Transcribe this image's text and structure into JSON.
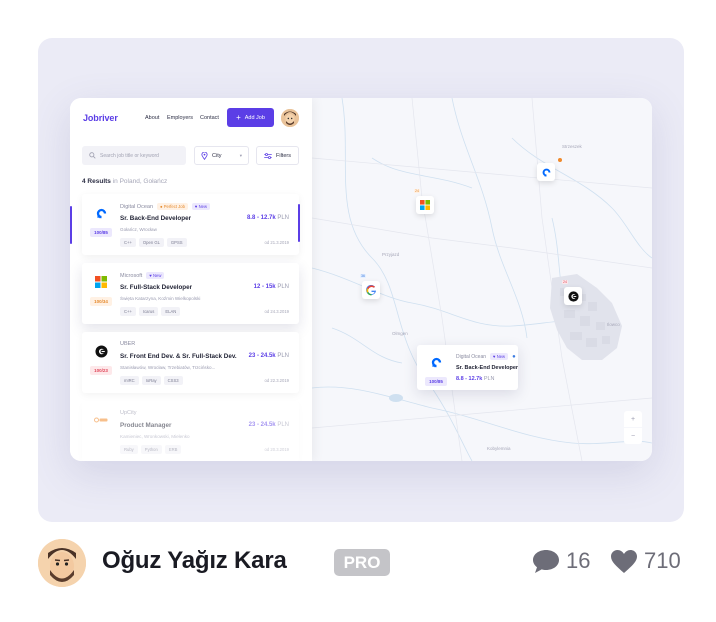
{
  "app": {
    "logo": "Jobriver",
    "nav": [
      "About",
      "Employers",
      "Contact"
    ],
    "add_job": "Add Job",
    "search_placeholder": "Search job title or keyword",
    "city": "City",
    "filters": "Filters",
    "results_count": "4 Results",
    "results_location": "in Poland, Gołańcz",
    "jobs": [
      {
        "score": "100/85",
        "company": "Digital Ocean",
        "badges": [
          "Perfect Job",
          "New"
        ],
        "title": "Sr. Back-End Developer",
        "salary": "8.8 - 12.7k",
        "currency": "PLN",
        "place": "Gołańcz, Wrocław",
        "tags": [
          "C++",
          "Open GL",
          "GPSS"
        ],
        "date": "od 21.3.2019"
      },
      {
        "score": "100/34",
        "company": "Microsoft",
        "badges": [
          "New"
        ],
        "title": "Sr. Full-Stack Developer",
        "salary": "12 - 15k",
        "currency": "PLN",
        "place": "Święta Katarzyna, Koźmin Wielkopolski",
        "tags": [
          "C++",
          "Icarus",
          "ELAN"
        ],
        "date": "od 24.3.2019"
      },
      {
        "score": "100/23",
        "company": "UBER",
        "badges": [],
        "title": "Sr. Front End Dev. & Sr. Full-Stack Dev.",
        "salary": "23 - 24.5k",
        "currency": "PLN",
        "place": "Stanisławów, Wrocław, Trzebiatów, Trzcińsko...",
        "tags": [
          "mIRC",
          "IoRay",
          "CSS3"
        ],
        "date": "od 22.3.2019"
      },
      {
        "score": "",
        "company": "UpCity",
        "badges": [],
        "title": "Product Manager",
        "salary": "23 - 24.5k",
        "currency": "PLN",
        "place": "Kamieniec, Wronkowski, Mielenko",
        "tags": [
          "Ruby",
          "Python",
          "ERB"
        ],
        "date": "od 20.3.2019"
      }
    ],
    "map": {
      "place_labels": [
        "Strzeszek",
        "Przyjazd",
        "Olmgen",
        "Kobylemnia",
        "Ilowco"
      ],
      "pin_counts": [
        "24",
        "36",
        "24"
      ],
      "popup": {
        "company": "Digital Ocean",
        "badge": "New",
        "title": "Sr. Back-End Developer",
        "salary": "8.8 - 12.7k",
        "currency": "PLN",
        "score": "100/85"
      },
      "zoom_in": "+",
      "zoom_out": "−"
    }
  },
  "footer": {
    "author": "Oğuz Yağız Kara",
    "pro": "PRO",
    "comments": "16",
    "likes": "710"
  },
  "colors": {
    "accent": "#5b3ee6",
    "orange": "#e58a2d",
    "bg": "#ebebf6"
  }
}
